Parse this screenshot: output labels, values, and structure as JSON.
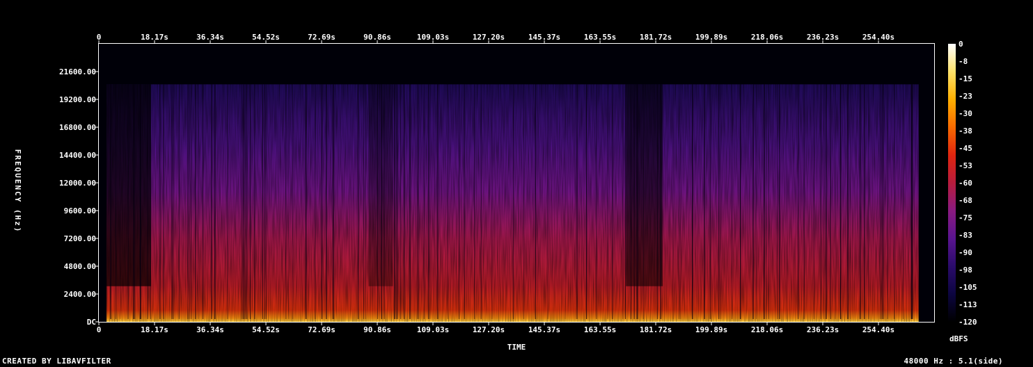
{
  "chart_data": {
    "type": "heatmap",
    "title": "",
    "xlabel": "TIME",
    "ylabel": "FREQUENCY (Hz)",
    "x_ticks": [
      "0",
      "18.17s",
      "36.34s",
      "54.52s",
      "72.69s",
      "90.86s",
      "109.03s",
      "127.20s",
      "145.37s",
      "163.55s",
      "181.72s",
      "199.89s",
      "218.06s",
      "236.23s",
      "254.40s"
    ],
    "x_tick_values": [
      0,
      18.17,
      36.34,
      54.52,
      72.69,
      90.86,
      109.03,
      127.2,
      145.37,
      163.55,
      181.72,
      199.89,
      218.06,
      236.23,
      254.4
    ],
    "xlim": [
      0,
      272.57
    ],
    "y_ticks": [
      "DC",
      "2400.00",
      "4800.00",
      "7200.00",
      "9600.00",
      "12000.00",
      "14400.00",
      "16800.00",
      "19200.00",
      "21600.00"
    ],
    "y_tick_values": [
      0,
      2400,
      4800,
      7200,
      9600,
      12000,
      14400,
      16800,
      19200,
      21600
    ],
    "ylim": [
      0,
      24000
    ],
    "colorbar": {
      "unit": "dBFS",
      "ticks": [
        "0",
        "-8",
        "-15",
        "-23",
        "-30",
        "-38",
        "-45",
        "-53",
        "-60",
        "-68",
        "-75",
        "-83",
        "-90",
        "-98",
        "-105",
        "-113",
        "-120"
      ],
      "range": [
        -120,
        0
      ],
      "colors": [
        "#000000",
        "#0c0540",
        "#2a0b6a",
        "#5a1490",
        "#8a1a80",
        "#b81c3c",
        "#e0250f",
        "#f76a00",
        "#ffb000",
        "#ffe36a",
        "#ffffff"
      ]
    },
    "content_cutoff_hz": 20500,
    "content_start_s": 2.5,
    "content_end_s": 267.5
  },
  "footer": {
    "left": "CREATED BY LIBAVFILTER",
    "right": "48000 Hz : 5.1(side)"
  }
}
